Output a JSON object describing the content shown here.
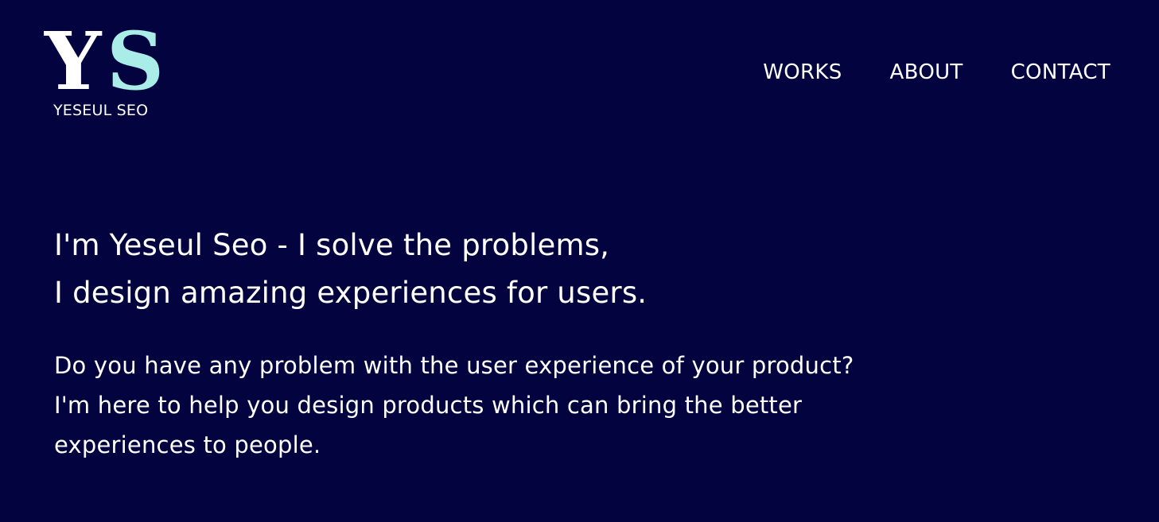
{
  "brand": {
    "logo_letter_y": "Y",
    "logo_letter_s": "S",
    "name": "YESEUL SEO",
    "colors": {
      "y": "#ffffff",
      "s": "#a9ece8",
      "background": "#03033f"
    }
  },
  "nav": {
    "items": [
      {
        "label": "WORKS"
      },
      {
        "label": "ABOUT"
      },
      {
        "label": "CONTACT"
      }
    ]
  },
  "hero": {
    "headline_line1": "I'm Yeseul Seo - I solve the problems,",
    "headline_line2": "I design amazing experiences for users.",
    "intro": "Do you have any problem with the user experience of your product? I'm here to help you design products which can bring the better experiences to people."
  }
}
